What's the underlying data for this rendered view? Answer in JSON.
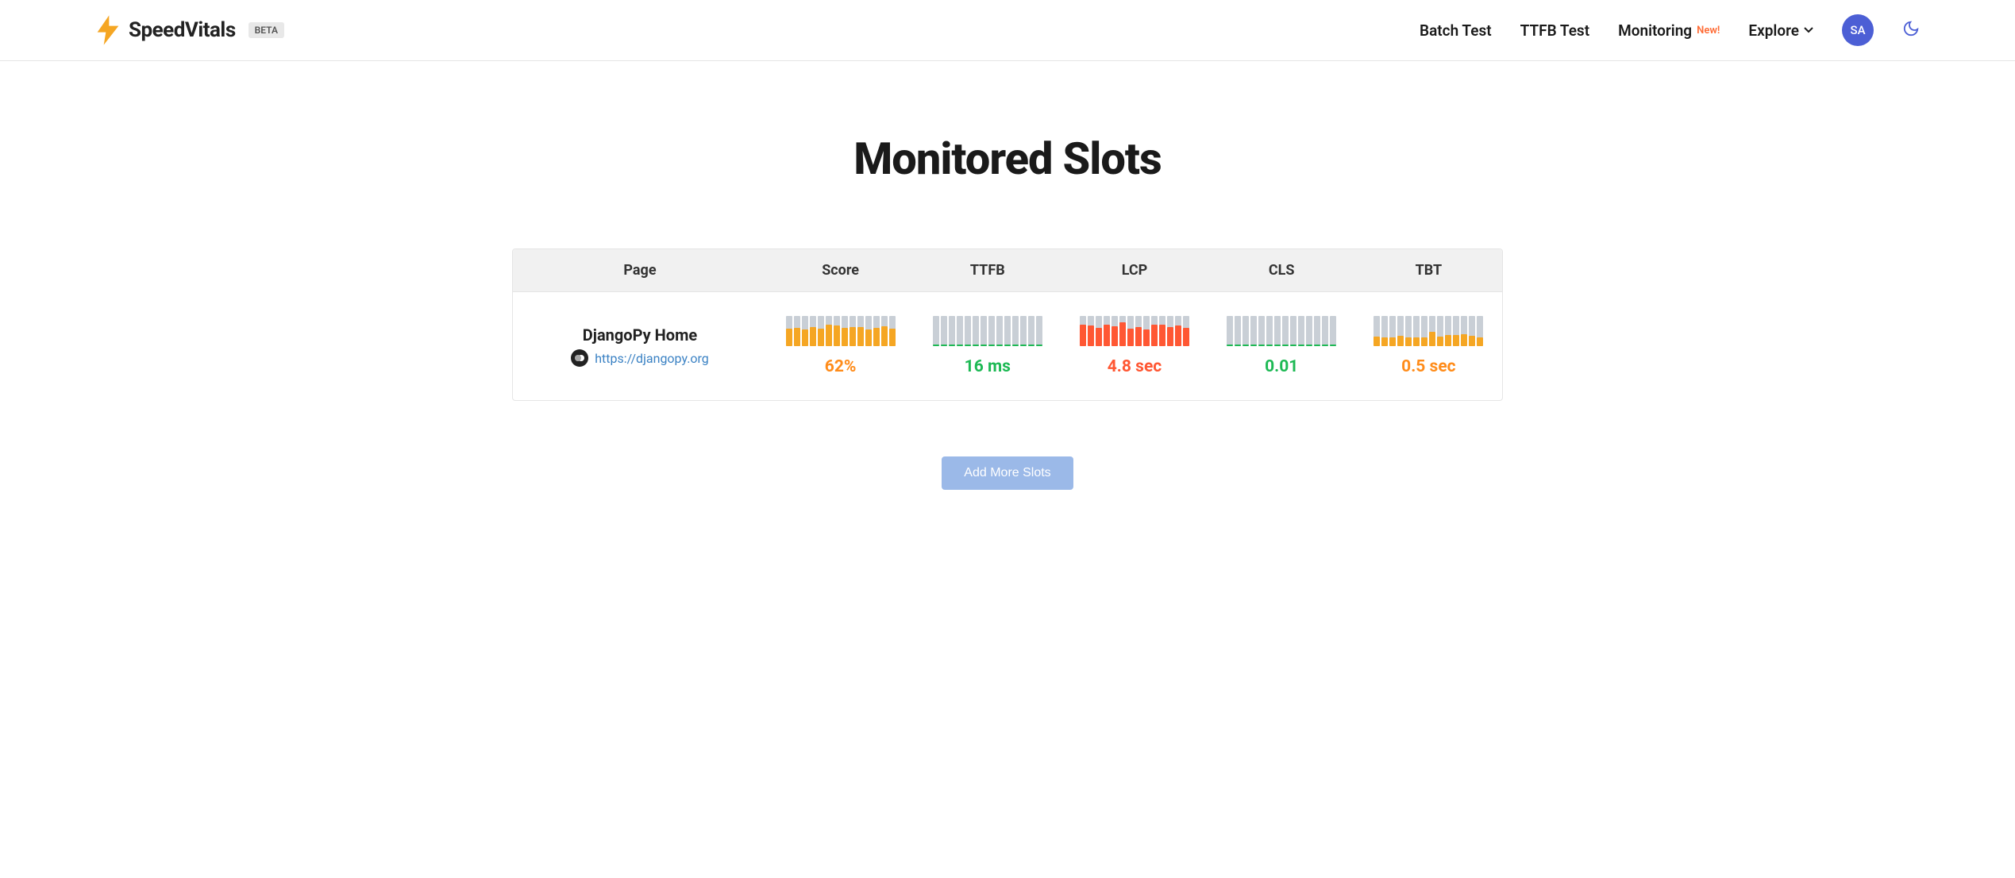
{
  "header": {
    "brand": "SpeedVitals",
    "beta": "BETA",
    "nav": {
      "batch": "Batch Test",
      "ttfb": "TTFB Test",
      "monitoring": "Monitoring",
      "new_tag": "New!",
      "explore": "Explore"
    },
    "avatar": "SA"
  },
  "title": "Monitored Slots",
  "columns": {
    "page": "Page",
    "score": "Score",
    "ttfb": "TTFB",
    "lcp": "LCP",
    "cls": "CLS",
    "tbt": "TBT"
  },
  "row": {
    "name": "DjangoPy Home",
    "url": "https://djangopy.org",
    "score": {
      "value": "62%",
      "color": "orange",
      "bars": [
        58,
        60,
        55,
        62,
        58,
        70,
        68,
        60,
        64,
        62,
        55,
        60,
        66,
        58
      ],
      "bar_color": "#f5a623",
      "bg": "#c9cfd6",
      "baseline": false
    },
    "ttfb": {
      "value": "16 ms",
      "color": "green",
      "bars": [
        4,
        4,
        4,
        4,
        4,
        4,
        4,
        4,
        4,
        4,
        4,
        4,
        4,
        4
      ],
      "bar_color": "#1db954",
      "bg": "#c9cfd6",
      "baseline": true
    },
    "lcp": {
      "value": "4.8 sec",
      "color": "red",
      "bars": [
        72,
        68,
        60,
        70,
        65,
        78,
        58,
        62,
        55,
        70,
        72,
        64,
        68,
        60
      ],
      "bar_color": "#ff5733",
      "bg": "#c9cfd6",
      "baseline": false
    },
    "cls": {
      "value": "0.01",
      "color": "green",
      "bars": [
        4,
        4,
        4,
        4,
        4,
        4,
        4,
        4,
        4,
        4,
        4,
        4,
        4,
        4
      ],
      "bar_color": "#1db954",
      "bg": "#c9cfd6",
      "baseline": true
    },
    "tbt": {
      "value": "0.5 sec",
      "color": "orange",
      "bars": [
        32,
        28,
        30,
        34,
        30,
        28,
        30,
        48,
        32,
        36,
        38,
        40,
        34,
        30
      ],
      "bar_color": "#f5a623",
      "bg": "#c9cfd6",
      "baseline": false
    }
  },
  "add_button": "Add More Slots"
}
